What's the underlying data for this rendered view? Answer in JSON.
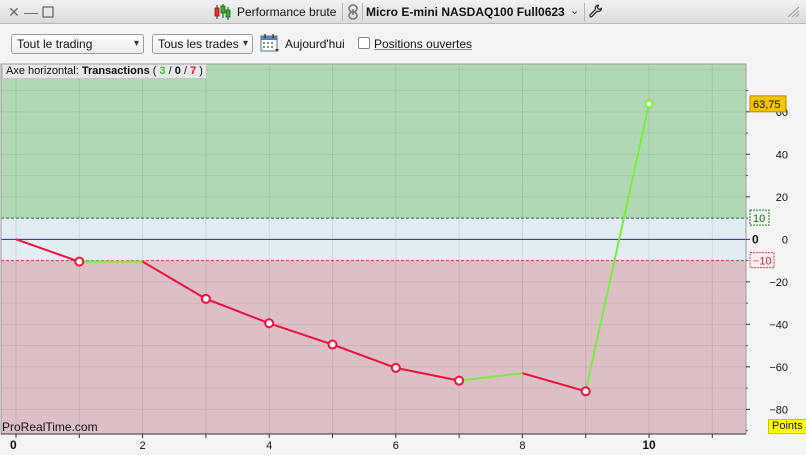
{
  "window": {
    "title": "Performance brute",
    "instrument": "Micro E-mini NASDAQ100 Full0623"
  },
  "toolbar": {
    "scope_select": "Tout le trading",
    "trades_select": "Tous les trades",
    "date_label": "Aujourd'hui",
    "positions_label": "Positions ouvertes",
    "positions_checked": false
  },
  "icons": {
    "close": "close-icon",
    "minimize": "minimize-icon",
    "maximize": "maximize-icon",
    "candles": "candlestick-icon",
    "link": "link-icon",
    "wrench": "wrench-icon",
    "calendar": "calendar-icon",
    "resize": "resize-grip-icon"
  },
  "chart_header": {
    "prefix": "Axe horizontal:",
    "name": "Transactions",
    "open_paren": "(",
    "wins": "3",
    "sep1": "/",
    "neutral": "0",
    "sep2": "/",
    "losses": "7",
    "close_paren": ")"
  },
  "watermark": "ProRealTime.com",
  "units_label": "Points",
  "colors": {
    "profit_zone": "#b2d9b6",
    "neutral_zone": "#e2ecf3",
    "loss_zone": "#dcc0c6",
    "win_line": "#78ee3c",
    "loss_line": "#f0103c",
    "zero_line": "#2a2a9a",
    "last_value_bg": "#f6c400"
  },
  "chart_data": {
    "type": "line",
    "x": [
      0,
      1,
      2,
      3,
      4,
      5,
      6,
      7,
      8,
      9,
      10
    ],
    "y": [
      0,
      -10.5,
      -10.5,
      -28,
      -39.5,
      -49.5,
      -60.5,
      -66.5,
      -63,
      -71.5,
      63.75
    ],
    "segment_outcomes": [
      "loss",
      "win",
      "loss",
      "loss",
      "loss",
      "loss",
      "loss",
      "win",
      "loss",
      "win"
    ],
    "x_ticks": [
      "0",
      "2",
      "4",
      "6",
      "8",
      "10"
    ],
    "x_tick_values": [
      0,
      2,
      4,
      6,
      8,
      10
    ],
    "y_ticks": [
      "60",
      "40",
      "20",
      "0",
      "−20",
      "−40",
      "−60",
      "−80"
    ],
    "y_tick_values": [
      60,
      40,
      20,
      0,
      -20,
      -40,
      -60,
      -80
    ],
    "ylim": [
      -91.6,
      82.5
    ],
    "xlim": [
      0,
      11.5
    ],
    "upper_threshold": 10,
    "upper_threshold_label": "10",
    "lower_threshold": -10,
    "lower_threshold_label": "−10",
    "last_value_label": "63,75",
    "grid": true
  }
}
